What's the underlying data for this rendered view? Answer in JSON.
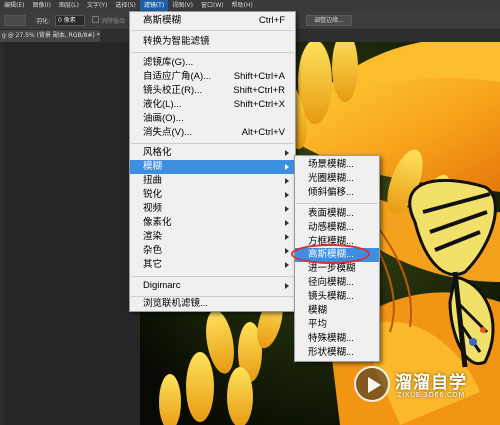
{
  "menubar": {
    "items": [
      {
        "label": "编辑(E)",
        "active": false
      },
      {
        "label": "图像(I)",
        "active": false
      },
      {
        "label": "图层(L)",
        "active": false
      },
      {
        "label": "文字(Y)",
        "active": false
      },
      {
        "label": "选择(S)",
        "active": false
      },
      {
        "label": "滤镜(T)",
        "active": true
      },
      {
        "label": "视图(V)",
        "active": false
      },
      {
        "label": "窗口(W)",
        "active": false
      },
      {
        "label": "帮助(H)",
        "active": false
      }
    ]
  },
  "options": {
    "feather_label": "羽化:",
    "feather_value": "0 像素",
    "antialias_label": "消除锯齿",
    "refine_button": "调整边缘..."
  },
  "document": {
    "tab_label": "g @ 27.5% (背景 副本, RGB/8#) *",
    "close_glyph": "×"
  },
  "filter_menu": {
    "items": [
      {
        "label": "高斯模糊",
        "shortcut": "Ctrl+F",
        "submenu": false
      },
      {
        "label": "转换为智能滤镜",
        "shortcut": "",
        "submenu": false
      },
      {
        "label": "滤镜库(G)...",
        "shortcut": "",
        "submenu": false
      },
      {
        "label": "自适应广角(A)...",
        "shortcut": "Shift+Ctrl+A",
        "submenu": false
      },
      {
        "label": "镜头校正(R)...",
        "shortcut": "Shift+Ctrl+R",
        "submenu": false
      },
      {
        "label": "液化(L)...",
        "shortcut": "Shift+Ctrl+X",
        "submenu": false
      },
      {
        "label": "油画(O)...",
        "shortcut": "",
        "submenu": false
      },
      {
        "label": "消失点(V)...",
        "shortcut": "Alt+Ctrl+V",
        "submenu": false
      },
      {
        "label": "风格化",
        "shortcut": "",
        "submenu": true
      },
      {
        "label": "模糊",
        "shortcut": "",
        "submenu": true,
        "highlighted": true
      },
      {
        "label": "扭曲",
        "shortcut": "",
        "submenu": true
      },
      {
        "label": "锐化",
        "shortcut": "",
        "submenu": true
      },
      {
        "label": "视频",
        "shortcut": "",
        "submenu": true
      },
      {
        "label": "像素化",
        "shortcut": "",
        "submenu": true
      },
      {
        "label": "渲染",
        "shortcut": "",
        "submenu": true
      },
      {
        "label": "杂色",
        "shortcut": "",
        "submenu": true
      },
      {
        "label": "其它",
        "shortcut": "",
        "submenu": true
      },
      {
        "label": "Digimarc",
        "shortcut": "",
        "submenu": true
      },
      {
        "label": "浏览联机滤镜...",
        "shortcut": "",
        "submenu": false
      }
    ]
  },
  "blur_submenu": {
    "items": [
      {
        "label": "场景模糊..."
      },
      {
        "label": "光圈模糊..."
      },
      {
        "label": "倾斜偏移..."
      },
      {
        "label": "表面模糊..."
      },
      {
        "label": "动感模糊..."
      },
      {
        "label": "方框模糊..."
      },
      {
        "label": "高斯模糊...",
        "highlighted": true
      },
      {
        "label": "进一步模糊"
      },
      {
        "label": "径向模糊..."
      },
      {
        "label": "镜头模糊..."
      },
      {
        "label": "模糊"
      },
      {
        "label": "平均"
      },
      {
        "label": "特殊模糊..."
      },
      {
        "label": "形状模糊..."
      }
    ]
  },
  "watermark": {
    "brand": "溜溜自学",
    "url": "ZIXUE.3D66.COM"
  },
  "colors": {
    "highlight": "#3d8de0",
    "menu_bg": "#f0f0f0",
    "annotation_circle": "#d93030"
  }
}
